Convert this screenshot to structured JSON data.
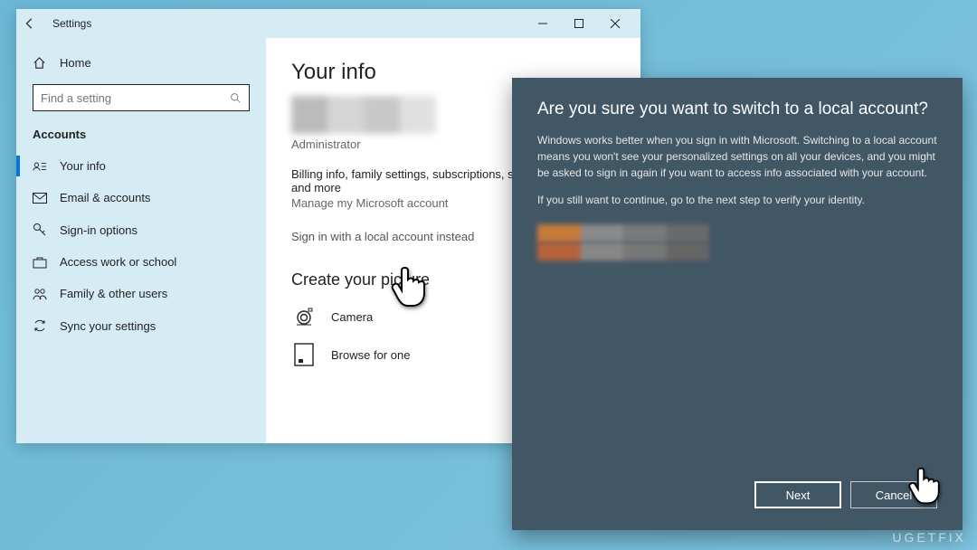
{
  "settings": {
    "title": "Settings",
    "home": "Home",
    "search_placeholder": "Find a setting",
    "section": "Accounts",
    "nav": [
      {
        "label": "Your info"
      },
      {
        "label": "Email & accounts"
      },
      {
        "label": "Sign-in options"
      },
      {
        "label": "Access work or school"
      },
      {
        "label": "Family & other users"
      },
      {
        "label": "Sync your settings"
      }
    ],
    "content": {
      "heading": "Your info",
      "role": "Administrator",
      "billing": "Billing info, family settings, subscriptions, security settings, and more",
      "manage": "Manage my Microsoft account",
      "local_link": "Sign in with a local account instead",
      "create_heading": "Create your picture",
      "camera": "Camera",
      "browse": "Browse for one"
    }
  },
  "dialog": {
    "title": "Are you sure you want to switch to a local account?",
    "body1": "Windows works better when you sign in with Microsoft. Switching to a local account means you won't see your personalized settings on all your devices, and you might be asked to sign in again if you want to access info associated with your account.",
    "body2": "If you still want to continue, go to the next step to verify your identity.",
    "next": "Next",
    "cancel": "Cancel"
  },
  "watermark": "UGETFIX"
}
